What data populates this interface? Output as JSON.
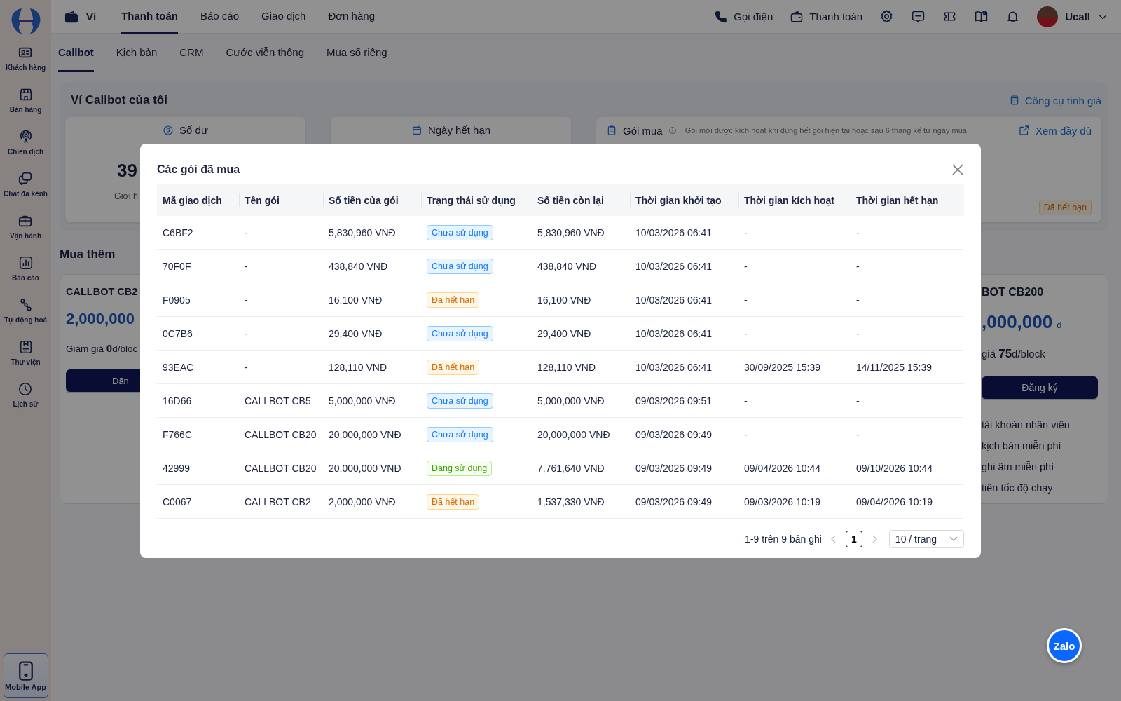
{
  "sidebar": {
    "items": [
      {
        "label": "Khách hàng"
      },
      {
        "label": "Bán hàng"
      },
      {
        "label": "Chiến dịch"
      },
      {
        "label": "Chat đa kênh"
      },
      {
        "label": "Vận hành"
      },
      {
        "label": "Báo cáo"
      },
      {
        "label": "Tự động hoá"
      },
      {
        "label": "Thư viện"
      },
      {
        "label": "Lịch sử"
      }
    ],
    "mobile_app": "Mobile App"
  },
  "topbar": {
    "section": "Ví",
    "tabs": [
      {
        "label": "Thanh toán",
        "selected": true
      },
      {
        "label": "Báo cáo",
        "selected": false
      },
      {
        "label": "Giao dịch",
        "selected": false
      },
      {
        "label": "Đơn hàng",
        "selected": false
      }
    ],
    "call": "Gọi điện",
    "payment": "Thanh toán",
    "user": "Ucall"
  },
  "subtabs": [
    {
      "label": "Callbot",
      "selected": true
    },
    {
      "label": "Kịch bản",
      "selected": false
    },
    {
      "label": "CRM",
      "selected": false
    },
    {
      "label": "Cước viễn thông",
      "selected": false
    },
    {
      "label": "Mua số riêng",
      "selected": false
    }
  ],
  "wallet": {
    "title": "Ví Callbot của tôi",
    "price_tool": "Công cụ tính giá",
    "balance": {
      "title": "Số dư",
      "value": "39",
      "caption": "Giới h"
    },
    "expiry": {
      "title": "Ngày hết hạn"
    },
    "packages": {
      "title": "Gói mua",
      "note": "Gói mới được kích hoạt khi dùng hết gói hiện tại hoặc sau 6 tháng kể từ ngày mua",
      "link": "Xem đầy đủ",
      "status": {
        "label": "Đã hết hạn",
        "kind": "expired"
      }
    }
  },
  "buy_more": {
    "title": "Mua thêm",
    "cards": [
      {
        "name": "CALLBOT CB2",
        "price": "2,000,000",
        "discount": "Giảm giá **0**đ/bloc",
        "button": "Đăn"
      },
      {
        "name": "BOT CB200",
        "price": ",000,000",
        "currency": "đ",
        "discount": "giá **75**đ/block",
        "button": "Đăng ký",
        "features": [
          "tài khoản nhân viên",
          "kịch bản miễn phí",
          "ghi âm miễn phí",
          "tiên tốc độ chạy"
        ]
      }
    ]
  },
  "modal": {
    "title": "Các gói đã mua",
    "columns": [
      "Mã giao dịch",
      "Tên gói",
      "Số tiền của gói",
      "Trạng thái sử dụng",
      "Số tiền còn lại",
      "Thời gian khởi tạo",
      "Thời gian kích hoạt",
      "Thời gian hết hạn"
    ],
    "rows": [
      {
        "cells": [
          "C6BF2",
          "-",
          "5,830,960 VNĐ",
          {
            "label": "Chưa sử dụng",
            "kind": "unused"
          },
          "5,830,960 VNĐ",
          "10/03/2026 06:41",
          "-",
          "-"
        ]
      },
      {
        "cells": [
          "70F0F",
          "-",
          "438,840 VNĐ",
          {
            "label": "Chưa sử dụng",
            "kind": "unused"
          },
          "438,840 VNĐ",
          "10/03/2026 06:41",
          "-",
          "-"
        ]
      },
      {
        "cells": [
          "F0905",
          "-",
          "16,100 VNĐ",
          {
            "label": "Đã hết hạn",
            "kind": "expired"
          },
          "16,100 VNĐ",
          "10/03/2026 06:41",
          "-",
          "-"
        ]
      },
      {
        "cells": [
          "0C7B6",
          "-",
          "29,400 VNĐ",
          {
            "label": "Chưa sử dụng",
            "kind": "unused"
          },
          "29,400 VNĐ",
          "10/03/2026 06:41",
          "-",
          "-"
        ]
      },
      {
        "cells": [
          "93EAC",
          "-",
          "128,110 VNĐ",
          {
            "label": "Đã hết hạn",
            "kind": "expired"
          },
          "128,110 VNĐ",
          "10/03/2026 06:41",
          "30/09/2025 15:39",
          "14/11/2025 15:39"
        ]
      },
      {
        "cells": [
          "16D66",
          "CALLBOT CB5",
          "5,000,000 VNĐ",
          {
            "label": "Chưa sử dụng",
            "kind": "unused"
          },
          "5,000,000 VNĐ",
          "09/03/2026 09:51",
          "-",
          "-"
        ]
      },
      {
        "cells": [
          "F766C",
          "CALLBOT CB20",
          "20,000,000 VNĐ",
          {
            "label": "Chưa sử dụng",
            "kind": "unused"
          },
          "20,000,000 VNĐ",
          "09/03/2026 09:49",
          "-",
          "-"
        ]
      },
      {
        "cells": [
          "42999",
          "CALLBOT CB20",
          "20,000,000 VNĐ",
          {
            "label": "Đang sử dụng",
            "kind": "in_use"
          },
          "7,761,640 VNĐ",
          "09/03/2026 09:49",
          "09/04/2026 10:44",
          "09/10/2026 10:44"
        ]
      },
      {
        "cells": [
          "C0067",
          "CALLBOT CB2",
          "2,000,000 VNĐ",
          {
            "label": "Đã hết hạn",
            "kind": "expired"
          },
          "1,537,330 VNĐ",
          "09/03/2026 09:49",
          "09/03/2026 10:19",
          "09/04/2026 10:19"
        ]
      }
    ],
    "pagination": {
      "summary": "1-9 trên 9 bản ghi",
      "pages": [
        {
          "label": "1",
          "selected": true
        }
      ],
      "page_size": "10 / trang"
    }
  },
  "chat_widget": {
    "label": "Zalo"
  }
}
